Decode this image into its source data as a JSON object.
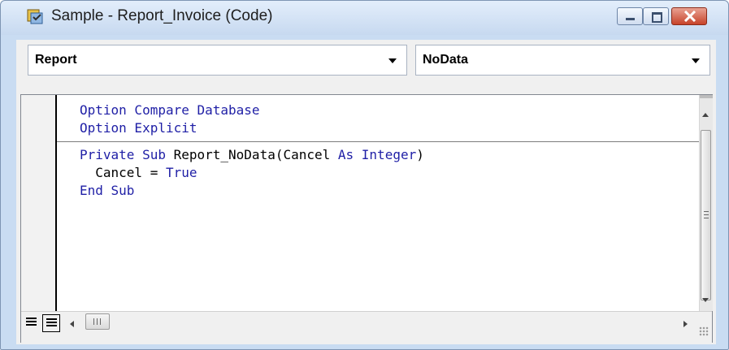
{
  "window": {
    "title": "Sample - Report_Invoice (Code)",
    "icon": "access-code-icon",
    "buttons": {
      "minimize": "minimize-icon",
      "maximize": "maximize-icon",
      "close": "close-icon"
    },
    "accent": "#c7432a"
  },
  "combos": {
    "object": {
      "value": "Report"
    },
    "procedure": {
      "value": "NoData"
    }
  },
  "code": {
    "keyword_color": "#1f1fa6",
    "declarations": [
      [
        {
          "t": "Option Compare Database",
          "kw": true
        }
      ],
      [
        {
          "t": "Option Explicit",
          "kw": true
        }
      ]
    ],
    "procedure": [
      [
        {
          "t": "Private Sub",
          "kw": true
        },
        {
          "t": " Report_NoData(Cancel ",
          "kw": false
        },
        {
          "t": "As Integer",
          "kw": true
        },
        {
          "t": ")",
          "kw": false
        }
      ],
      [
        {
          "t": "  Cancel = ",
          "kw": false
        },
        {
          "t": "True",
          "kw": true
        }
      ],
      [
        {
          "t": "End Sub",
          "kw": true
        }
      ]
    ]
  },
  "bottom": {
    "view_procedure": "procedure-view-icon",
    "view_full": "full-module-view-icon"
  }
}
